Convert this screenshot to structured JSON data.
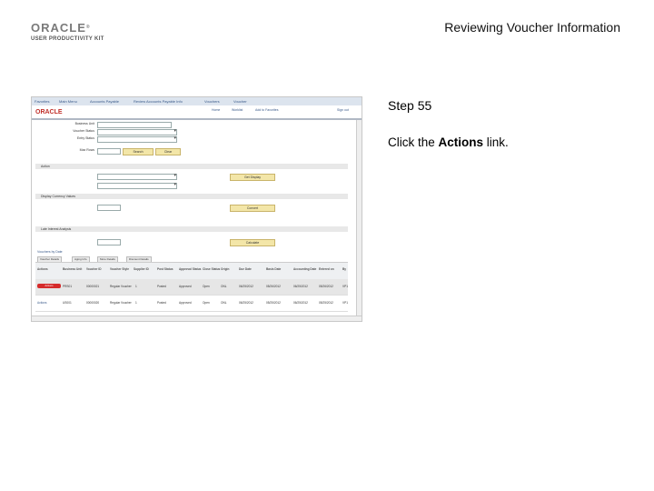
{
  "logo": {
    "brand": "ORACLE",
    "reg": "®",
    "subtitle": "USER PRODUCTIVITY KIT"
  },
  "header": {
    "title": "Reviewing Voucher Information"
  },
  "step": {
    "label": "Step 55"
  },
  "instruction": {
    "prefix": "Click the ",
    "target": "Actions",
    "suffix": " link."
  },
  "screenshot": {
    "nav_items": [
      "Favorites",
      "Main Menu",
      "Accounts Payable",
      "Review Accounts Payable Info",
      "Vouchers",
      "Voucher"
    ],
    "oracle_logo": "ORACLE",
    "header_links": [
      "Home",
      "Worklist",
      "Add to Favorites",
      "Sign out"
    ],
    "fields": [
      {
        "label": "Business Unit"
      },
      {
        "label": "Voucher Status"
      },
      {
        "label": "Entry Status"
      },
      {
        "label": "Max Rows"
      }
    ],
    "buttons": {
      "search": "Search",
      "clear": "Clear",
      "get_display": "Get Display",
      "convert": "Convert",
      "calculate": "Calculate"
    },
    "sections": [
      "Action",
      "Display Currency Values",
      "Late Interest Analysis"
    ],
    "grid_title": "Vouchers by Date",
    "tabs": [
      "Voucher Details",
      "Aging Info",
      "More Details",
      "Discount Details"
    ],
    "columns": [
      "Actions",
      "Business Unit",
      "Voucher ID",
      "Voucher Style",
      "Supplier ID",
      "Post Status",
      "Approval Status",
      "Close Status",
      "Origin",
      "Due Date",
      "Basis Date",
      "Accounting Date",
      "Entered on",
      "By"
    ],
    "rows": [
      [
        "Actions",
        "PRS01",
        "00000021",
        "Regular Voucher",
        "1",
        "Posted",
        "Approved",
        "Open",
        "ONL",
        "06/25/2012",
        "05/26/2012",
        "06/25/2012",
        "05/26/2012",
        "VP1"
      ],
      [
        "Actions",
        "US001",
        "00000020",
        "Regular Voucher",
        "1",
        "Posted",
        "Approved",
        "Open",
        "ONL",
        "06/25/2012",
        "05/25/2012",
        "06/25/2012",
        "05/25/2012",
        "VP1"
      ]
    ]
  }
}
